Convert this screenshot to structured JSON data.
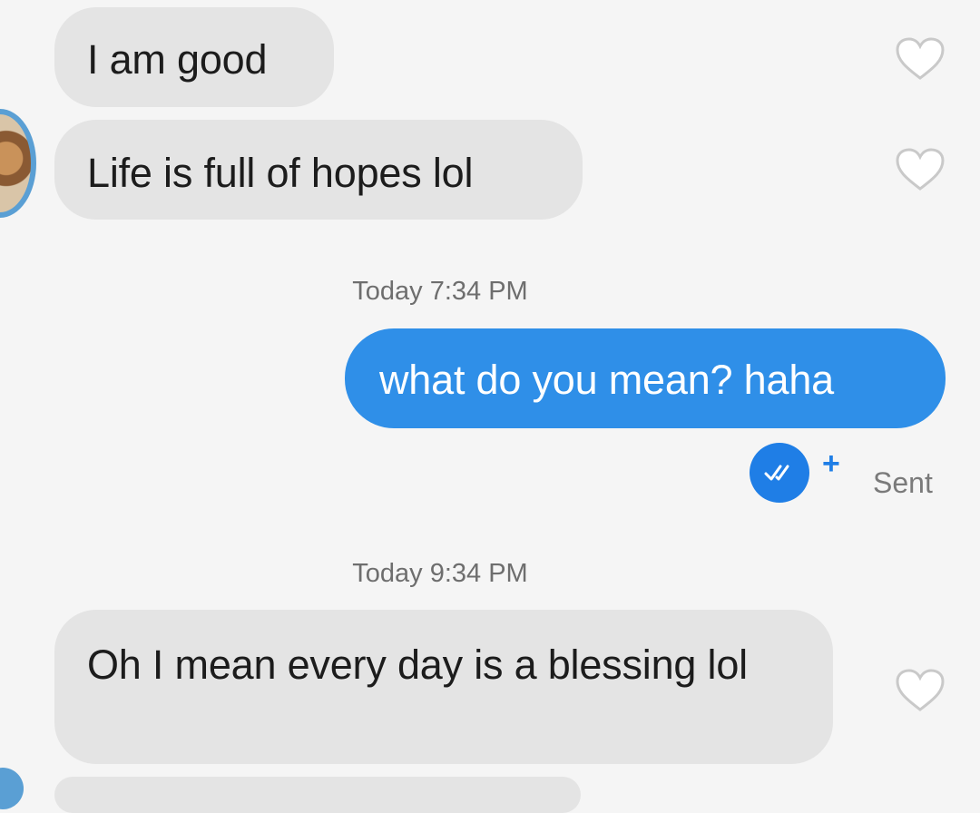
{
  "conversation": {
    "messages": [
      {
        "sender": "other",
        "text": "I am good"
      },
      {
        "sender": "other",
        "text": "Life is full of hopes lol"
      },
      {
        "sender": "me",
        "text": "what do you mean? haha"
      },
      {
        "sender": "other",
        "text": "Oh I mean every day is a blessing lol"
      }
    ],
    "timestamps": [
      "Today 7:34 PM",
      "Today 9:34 PM"
    ],
    "status": {
      "label": "Sent",
      "plus": "+"
    }
  },
  "colors": {
    "incoming_bubble": "#e4e4e4",
    "outgoing_bubble": "#2f8fe8",
    "background": "#f5f5f5",
    "status_badge": "#1f7ee6"
  }
}
